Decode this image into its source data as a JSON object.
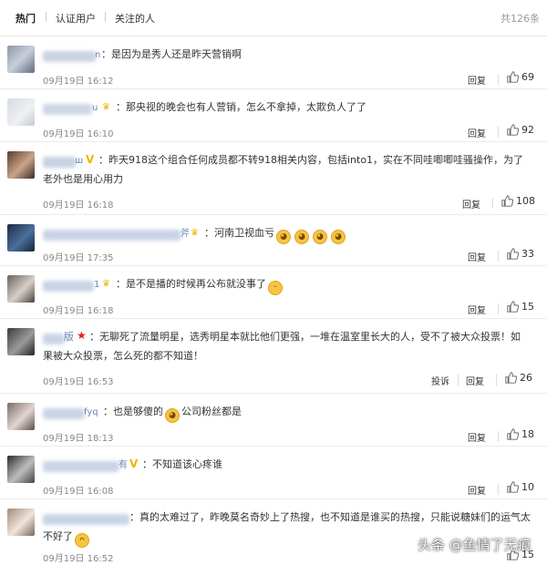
{
  "tabs": [
    "热门",
    "认证用户",
    "关注的人"
  ],
  "total": "共126条",
  "reply_label": "回复",
  "report_label": "投诉",
  "comments": [
    {
      "name_partial": "n",
      "text": "：是因为是秀人还是昨天营销啊",
      "time": "09月19日 16:12",
      "likes": "69"
    },
    {
      "name_partial": "u",
      "text": "：那央视的晚会也有人营销，怎么不拿掉，太欺负人了了",
      "time": "09月19日 16:10",
      "likes": "92"
    },
    {
      "name_partial": "ш",
      "text": "：昨天918这个组合任何成员都不转918相关内容，包括into1，实在不同哇唧唧哇骚操作，为了",
      "text2": "老外也是用心用力",
      "time": "09月19日 16:18",
      "likes": "108"
    },
    {
      "name_partial": "斧",
      "text": "：河南卫视血亏",
      "time": "09月19日 17:35",
      "likes": "33"
    },
    {
      "name_partial": "1",
      "text": "：是不是播的时候再公布就没事了",
      "time": "09月19日 16:18",
      "likes": "15"
    },
    {
      "name_partial": "版",
      "text": "：无聊死了流量明星，选秀明星本就比他们更强，一堆在温室里长大的人，受不了被大众投票！如",
      "text2": "果被大众投票，怎么死的都不知道！",
      "time": "09月19日 16:53",
      "likes": "26"
    },
    {
      "name_partial": "fyq",
      "text": "：也是够傻的",
      "text_after": "公司粉丝都是",
      "time": "09月19日 18:13",
      "likes": "18"
    },
    {
      "name_partial": "有",
      "text": "：不知道该心疼谁",
      "time": "09月19日 16:08",
      "likes": "10"
    },
    {
      "name_partial": "",
      "text": "：真的太难过了，昨晚莫名奇妙上了热搜，也不知道是谁买的热搜，只能说糖妹们的运气太",
      "text2": "不好了",
      "time": "09月19日 16:52",
      "likes": "15"
    }
  ],
  "watermark": "头条 @鱼情了无痕",
  "colors": {
    "accent": "#f5a623",
    "vip": "#f0b400",
    "link": "#333333"
  }
}
